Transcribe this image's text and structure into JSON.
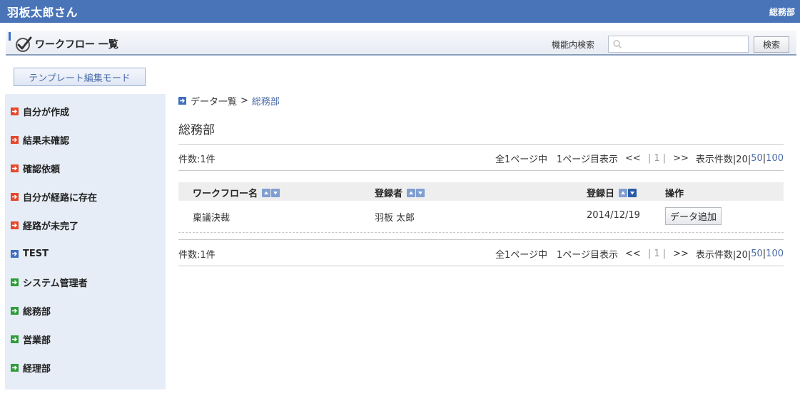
{
  "topbar": {
    "user_name": "羽板太郎さん",
    "dept": "総務部"
  },
  "appbar": {
    "title": "ワークフロー 一覧",
    "search_label": "機能内検索",
    "search_value": "",
    "search_button": "検索"
  },
  "template_button": "テンプレート編集モード",
  "sidebar": {
    "items": [
      {
        "label": "自分が作成",
        "icon": "arrow-right-icon-red",
        "color": "#e8462a"
      },
      {
        "label": "結果未確認",
        "icon": "arrow-right-icon-red",
        "color": "#e8462a"
      },
      {
        "label": "確認依頼",
        "icon": "arrow-right-icon-red",
        "color": "#e8462a"
      },
      {
        "label": "自分が経路に存在",
        "icon": "arrow-right-icon-red",
        "color": "#e8462a"
      },
      {
        "label": "経路が未完了",
        "icon": "arrow-right-icon-red",
        "color": "#e8462a"
      },
      {
        "label": "TEST",
        "icon": "arrow-right-icon-blue",
        "color": "#3f6fc0"
      },
      {
        "label": "システム管理者",
        "icon": "arrow-right-icon-green",
        "color": "#2f9c3a"
      },
      {
        "label": "総務部",
        "icon": "arrow-right-icon-green",
        "color": "#2f9c3a"
      },
      {
        "label": "営業部",
        "icon": "arrow-right-icon-green",
        "color": "#2f9c3a"
      },
      {
        "label": "経理部",
        "icon": "arrow-right-icon-green",
        "color": "#2f9c3a"
      }
    ]
  },
  "breadcrumb": {
    "home": "データ一覧",
    "separator": ">",
    "current": "総務部"
  },
  "page_title": "総務部",
  "list": {
    "count_text": "件数:1件",
    "pager": {
      "summary": "全1ページ中　1ページ目表示",
      "prev": "<<",
      "current_page": "| 1 |",
      "next": ">>",
      "per_page_label": "表示件数|20|",
      "per_page_50": "50",
      "per_page_sep": "|",
      "per_page_100": "100"
    },
    "columns": [
      "ワークフロー名",
      "登録者",
      "登録日",
      "操作"
    ],
    "rows": [
      {
        "name": "稟議決裁",
        "registrant": "羽板 太郎",
        "date": "2014/12/19",
        "action": "データ追加"
      }
    ]
  },
  "colors": {
    "topbar": "#4a74b8",
    "link": "#4a6aa5",
    "sidebar_bg": "#e6edf6"
  }
}
